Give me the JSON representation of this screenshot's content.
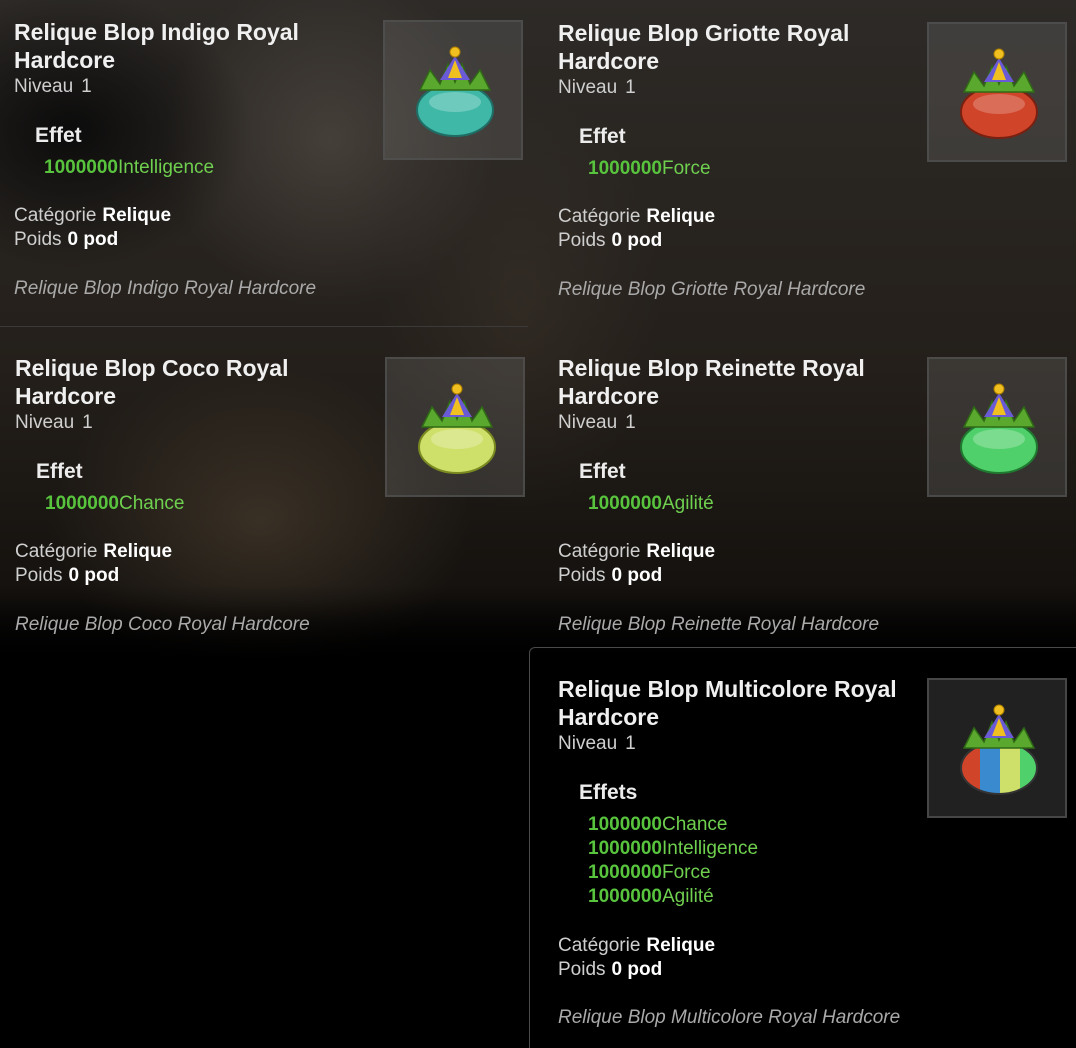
{
  "items": [
    {
      "title": "Relique Blop Indigo Royal Hardcore",
      "level_label": "Niveau",
      "level_value": "1",
      "effects_label": "Effet",
      "effects": [
        {
          "value": "1000000",
          "stat": "Intelligence"
        }
      ],
      "category_label": "Catégorie",
      "category_value": "Relique",
      "weight_label": "Poids",
      "weight_value": "0 pod",
      "description": "Relique Blop Indigo Royal Hardcore",
      "icon": "blop-indigo-royal-icon",
      "body_color": "#3fb8a8"
    },
    {
      "title": "Relique Blop Griotte Royal Hardcore",
      "level_label": "Niveau",
      "level_value": "1",
      "effects_label": "Effet",
      "effects": [
        {
          "value": "1000000",
          "stat": "Force"
        }
      ],
      "category_label": "Catégorie",
      "category_value": "Relique",
      "weight_label": "Poids",
      "weight_value": "0 pod",
      "description": "Relique Blop Griotte Royal Hardcore",
      "icon": "blop-griotte-royal-icon",
      "body_color": "#d0442a"
    },
    {
      "title": "Relique Blop Coco Royal Hardcore",
      "level_label": "Niveau",
      "level_value": "1",
      "effects_label": "Effet",
      "effects": [
        {
          "value": "1000000",
          "stat": "Chance"
        }
      ],
      "category_label": "Catégorie",
      "category_value": "Relique",
      "weight_label": "Poids",
      "weight_value": "0 pod",
      "description": "Relique Blop Coco Royal Hardcore",
      "icon": "blop-coco-royal-icon",
      "body_color": "#cfe06a"
    },
    {
      "title": "Relique Blop Reinette Royal Hardcore",
      "level_label": "Niveau",
      "level_value": "1",
      "effects_label": "Effet",
      "effects": [
        {
          "value": "1000000",
          "stat": "Agilité"
        }
      ],
      "category_label": "Catégorie",
      "category_value": "Relique",
      "weight_label": "Poids",
      "weight_value": "0 pod",
      "description": "Relique Blop Reinette Royal Hardcore",
      "icon": "blop-reinette-royal-icon",
      "body_color": "#4fd06a"
    },
    {
      "title": "Relique Blop Multicolore Royal Hardcore",
      "level_label": "Niveau",
      "level_value": "1",
      "effects_label": "Effets",
      "effects": [
        {
          "value": "1000000",
          "stat": "Chance"
        },
        {
          "value": "1000000",
          "stat": "Intelligence"
        },
        {
          "value": "1000000",
          "stat": "Force"
        },
        {
          "value": "1000000",
          "stat": "Agilité"
        }
      ],
      "category_label": "Catégorie",
      "category_value": "Relique",
      "weight_label": "Poids",
      "weight_value": "0 pod",
      "description": "Relique Blop Multicolore Royal Hardcore",
      "icon": "blop-multicolore-royal-icon",
      "body_color": "multicolor"
    }
  ],
  "colors": {
    "effect_green": "#58c43d",
    "text_light": "#f0f0f0",
    "description_grey": "#a9a9a9"
  }
}
